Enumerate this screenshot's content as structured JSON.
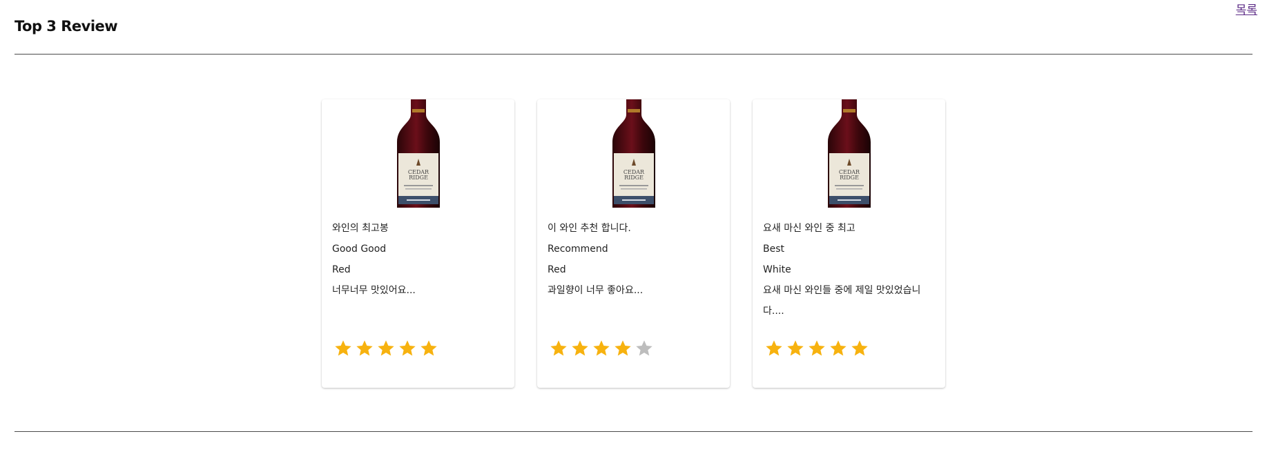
{
  "header": {
    "title": "Top 3 Review",
    "top_link": "목록"
  },
  "colors": {
    "star_filled": "#F7B20F",
    "star_empty": "#BDBDBD",
    "divider": "#4a4a4a"
  },
  "reviews": [
    {
      "title": "와인의 최고봉",
      "subtitle": "Good Good",
      "type": "Red",
      "content": "너무너무 맛있어요...",
      "rating": 5,
      "rating_max": 5
    },
    {
      "title": "이 와인 추천 합니다.",
      "subtitle": "Recommend",
      "type": "Red",
      "content": "과일향이 너무 좋아요...",
      "rating": 4,
      "rating_max": 5
    },
    {
      "title": "요새 마신 와인 중 최고",
      "subtitle": "Best",
      "type": "White",
      "content": "요새 마신 와인들 중에 제일 맛있었습니다....",
      "rating": 5,
      "rating_max": 5
    }
  ]
}
